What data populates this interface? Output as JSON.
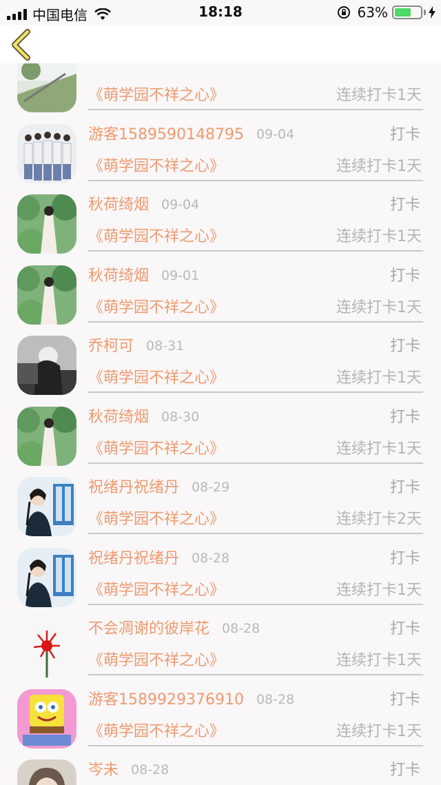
{
  "status_bar": {
    "carrier": "中国电信",
    "time": "18:18",
    "battery_percent": "63%",
    "battery_level": 0.63
  },
  "nav": {
    "back_icon": "chevron-left-icon"
  },
  "rows": [
    {
      "name": "",
      "date": "",
      "action": "",
      "book": "《萌学园不祥之心》",
      "streak": "连续打卡1天",
      "avatar": "landscape"
    },
    {
      "name": "游客1589590148795",
      "date": "09-04",
      "action": "打卡",
      "book": "《萌学园不祥之心》",
      "streak": "连续打卡1天",
      "avatar": "group"
    },
    {
      "name": "秋荷绮烟",
      "date": "09-04",
      "action": "打卡",
      "book": "《萌学园不祥之心》",
      "streak": "连续打卡1天",
      "avatar": "garden"
    },
    {
      "name": "秋荷绮烟",
      "date": "09-01",
      "action": "打卡",
      "book": "《萌学园不祥之心》",
      "streak": "连续打卡1天",
      "avatar": "garden"
    },
    {
      "name": "乔柯可",
      "date": "08-31",
      "action": "打卡",
      "book": "《萌学园不祥之心》",
      "streak": "连续打卡1天",
      "avatar": "mono"
    },
    {
      "name": "秋荷绮烟",
      "date": "08-30",
      "action": "打卡",
      "book": "《萌学园不祥之心》",
      "streak": "连续打卡1天",
      "avatar": "garden"
    },
    {
      "name": "祝绪丹祝绪丹",
      "date": "08-29",
      "action": "打卡",
      "book": "《萌学园不祥之心》",
      "streak": "连续打卡2天",
      "avatar": "portrait"
    },
    {
      "name": "祝绪丹祝绪丹",
      "date": "08-28",
      "action": "打卡",
      "book": "《萌学园不祥之心》",
      "streak": "连续打卡1天",
      "avatar": "portrait"
    },
    {
      "name": "不会凋谢的彼岸花",
      "date": "08-28",
      "action": "打卡",
      "book": "《萌学园不祥之心》",
      "streak": "连续打卡1天",
      "avatar": "flower"
    },
    {
      "name": "游客1589929376910",
      "date": "08-28",
      "action": "打卡",
      "book": "《萌学园不祥之心》",
      "streak": "连续打卡1天",
      "avatar": "sponge"
    },
    {
      "name": "岑未",
      "date": "08-28",
      "action": "打卡",
      "book": "",
      "streak": "",
      "avatar": "girl"
    }
  ]
}
